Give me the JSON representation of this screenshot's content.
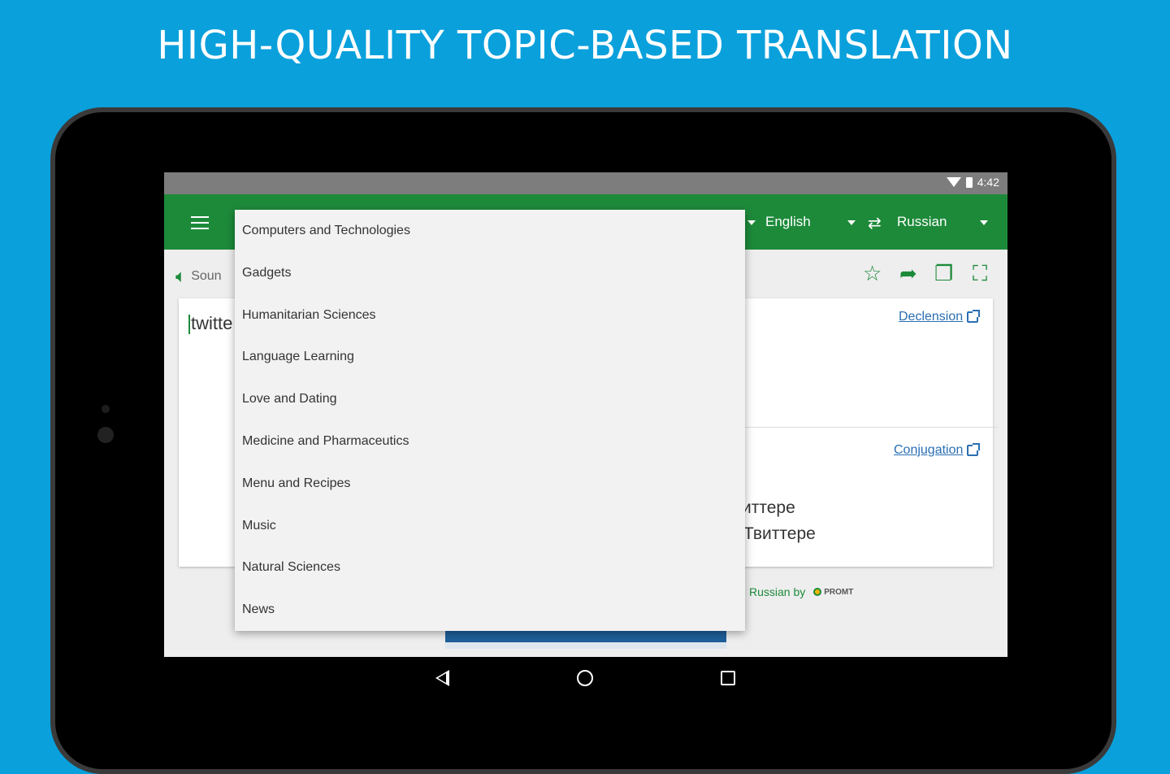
{
  "headline": "HIGH-QUALITY TOPIC-BASED TRANSLATION",
  "status": {
    "time": "4:42"
  },
  "appbar": {
    "source_lang": "English",
    "target_lang": "Russian"
  },
  "toolbar": {
    "sound_label": "Soun"
  },
  "input": {
    "text": "twitte"
  },
  "links": {
    "declension": "Declension",
    "conjugation": "Conjugation"
  },
  "results": [
    "иттере",
    "Твиттере"
  ],
  "powered_by": {
    "text": "Russian by",
    "logo": "PROMT"
  },
  "dropdown": {
    "items": [
      "Computers and Technologies",
      "Gadgets",
      "Humanitarian Sciences",
      "Language Learning",
      "Love and Dating",
      "Medicine and Pharmaceutics",
      "Menu and Recipes",
      "Music",
      "Natural Sciences",
      "News"
    ]
  },
  "colors": {
    "background": "#0aa0dc",
    "accent": "#1d8a3a",
    "link": "#2a6fb3"
  }
}
